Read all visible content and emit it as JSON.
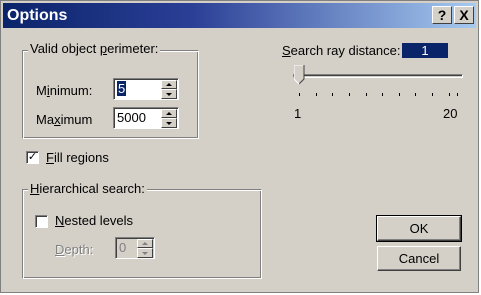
{
  "window": {
    "title": "Options",
    "help_label": "?",
    "close_label": "X"
  },
  "perimeter_group": {
    "title": "Valid object perimeter:",
    "minimum_label": "Minimum:",
    "minimum_value": "5",
    "maximum_label": "Maximum",
    "maximum_value": "5000"
  },
  "search_ray": {
    "label": "Search ray distance:",
    "value": "1",
    "slider_value": 1,
    "slider_min": 1,
    "slider_max": 20,
    "min_label": "1",
    "max_label": "20"
  },
  "fill_regions": {
    "label": "Fill regions",
    "checked": true,
    "check_mark": "✓"
  },
  "hierarchical_group": {
    "title": "Hierarchical search:",
    "nested_label": "Nested levels",
    "nested_checked": false,
    "depth_label": "Depth:",
    "depth_value": "0"
  },
  "buttons": {
    "ok_label": "OK",
    "cancel_label": "Cancel"
  },
  "colors": {
    "dialog_face": "#d4d0c8",
    "title_active": "#0a246a",
    "selection": "#0a246a"
  }
}
